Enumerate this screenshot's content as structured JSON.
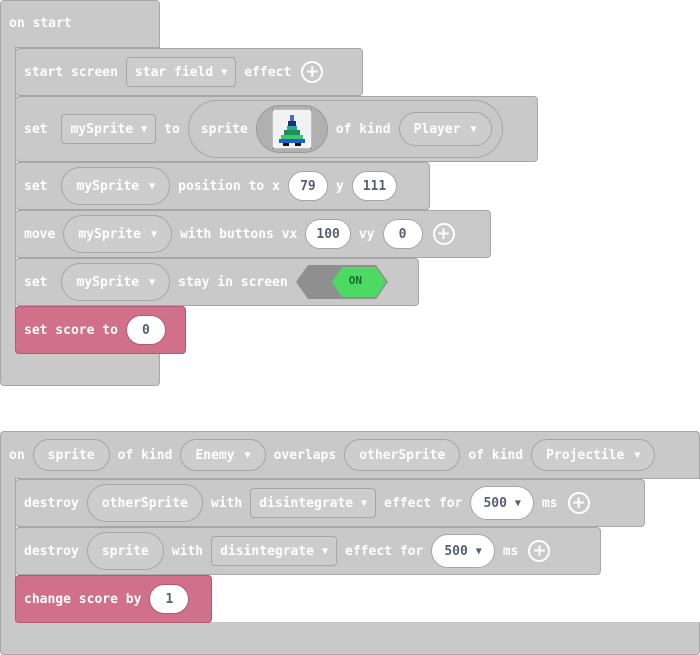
{
  "script1": {
    "hat": "on start",
    "b1": {
      "w1": "start screen",
      "dd": "star field",
      "w2": "effect"
    },
    "b2": {
      "w1": "set",
      "var": "mySprite",
      "w2": "to",
      "w3": "sprite",
      "w4": "of kind",
      "kind": "Player"
    },
    "b3": {
      "w1": "set",
      "var": "mySprite",
      "w2": "position to x",
      "x": "79",
      "w3": "y",
      "y": "111"
    },
    "b4": {
      "w1": "move",
      "var": "mySprite",
      "w2": "with buttons vx",
      "vx": "100",
      "w3": "vy",
      "vy": "0"
    },
    "b5": {
      "w1": "set",
      "var": "mySprite",
      "w2": "stay in screen",
      "toggle": "ON"
    },
    "b6": {
      "w1": "set score to",
      "val": "0"
    }
  },
  "script2": {
    "hat": {
      "w1": "on",
      "p1": "sprite",
      "w2": "of kind",
      "k1": "Enemy",
      "w3": "overlaps",
      "p2": "otherSprite",
      "w4": "of kind",
      "k2": "Projectile"
    },
    "b1": {
      "w1": "destroy",
      "p": "otherSprite",
      "w2": "with",
      "dd": "disintegrate",
      "w3": "effect for",
      "ms": "500",
      "w4": "ms"
    },
    "b2": {
      "w1": "destroy",
      "p": "sprite",
      "w2": "with",
      "dd": "disintegrate",
      "w3": "effect for",
      "ms": "500",
      "w4": "ms"
    },
    "b3": {
      "w1": "change score by",
      "val": "1"
    }
  },
  "icons": {
    "caret": "▼",
    "plus": "plus-icon",
    "sprite_thumb": "sprite-image-icon"
  },
  "colors": {
    "block": "#c9c9c9",
    "pink": "#d0708a",
    "toggle_on": "#4cd964",
    "text": "#ffffff"
  }
}
